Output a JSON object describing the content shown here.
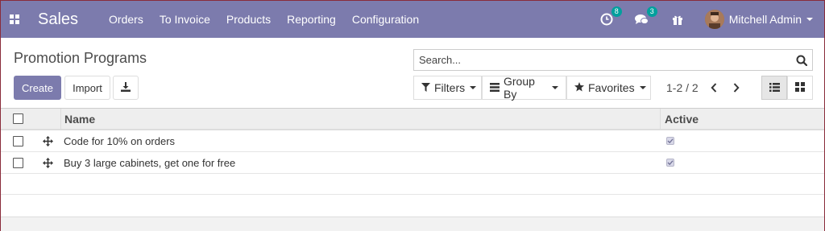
{
  "navbar": {
    "brand": "Sales",
    "menu": [
      {
        "label": "Orders"
      },
      {
        "label": "To Invoice"
      },
      {
        "label": "Products"
      },
      {
        "label": "Reporting"
      },
      {
        "label": "Configuration"
      }
    ],
    "activity_badge": "8",
    "messages_badge": "3",
    "user_name": "Mitchell Admin",
    "colors": {
      "navbar_bg": "#7c7bad",
      "badge_bg": "#00a09d"
    }
  },
  "control_panel": {
    "title": "Promotion Programs",
    "search_placeholder": "Search...",
    "create_label": "Create",
    "import_label": "Import",
    "filters_label": "Filters",
    "groupby_label": "Group By",
    "favorites_label": "Favorites",
    "pager": "1-2 / 2"
  },
  "list": {
    "columns": {
      "name": "Name",
      "active": "Active"
    },
    "rows": [
      {
        "name": "Code for 10% on orders",
        "active": true
      },
      {
        "name": "Buy 3 large cabinets, get one for free",
        "active": true
      }
    ]
  }
}
